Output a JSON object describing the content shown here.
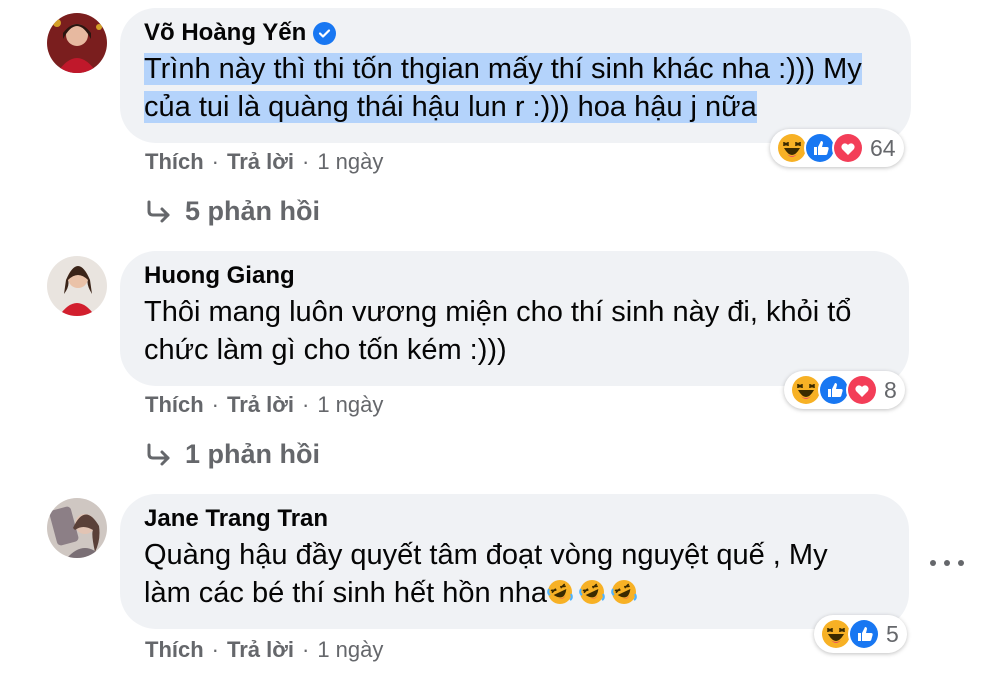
{
  "comments": [
    {
      "author": "Võ Hoàng Yến",
      "verified": true,
      "text_line1": "Trình này thì thi tốn thgian mấy thí sinh khác nha :))) My",
      "text_line2": "của tui là quàng thái hậu lun r :))) hoa hậu j nữa",
      "like_label": "Thích",
      "reply_label": "Trả lời",
      "time": "1 ngày",
      "reaction_count": "64",
      "reactions": [
        "haha-icon",
        "like-icon",
        "love-icon"
      ],
      "replies_label": "5 phản hồi"
    },
    {
      "author": "Huong Giang",
      "verified": false,
      "text_line1": "Thôi mang luôn vương miện cho thí sinh này đi, khỏi tổ",
      "text_line2": "chức làm gì cho tốn kém :)))",
      "like_label": "Thích",
      "reply_label": "Trả lời",
      "time": "1 ngày",
      "reaction_count": "8",
      "reactions": [
        "haha-icon",
        "like-icon",
        "love-icon"
      ],
      "replies_label": "1 phản hồi"
    },
    {
      "author": "Jane Trang Tran",
      "verified": false,
      "text_line1": "Quàng hậu đầy quyết tâm đoạt vòng nguyệt quế , My",
      "text_line2": "làm các bé thí sinh hết hồn nha",
      "like_label": "Thích",
      "reply_label": "Trả lời",
      "time": "1 ngày",
      "reaction_count": "5",
      "reactions": [
        "haha-icon",
        "like-icon"
      ]
    }
  ],
  "separator_dot": "·",
  "colors": {
    "bubble": "#f0f2f5",
    "secondary_text": "#65676b",
    "verified": "#1877f2",
    "selection": "#b4d3fb",
    "like": "#1877f2",
    "love": "#f33e58",
    "haha": "#f7b125"
  }
}
